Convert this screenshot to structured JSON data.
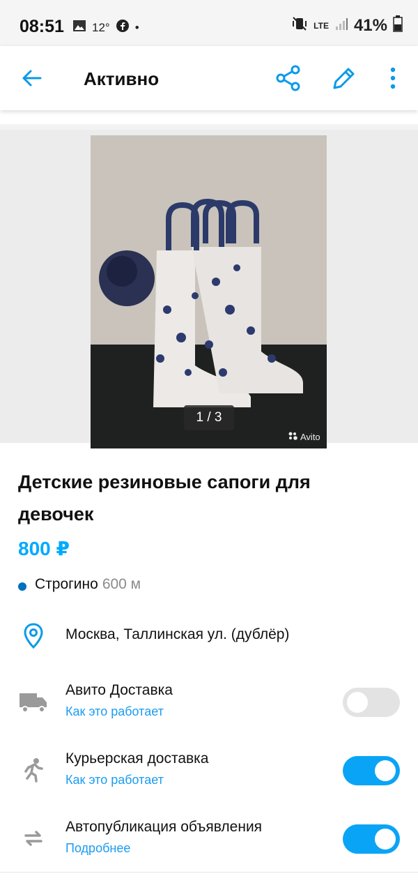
{
  "status_bar": {
    "time": "08:51",
    "temperature": "12°",
    "battery": "41%",
    "network": "LTE",
    "network_sub": "Vo)) LTE1"
  },
  "app_bar": {
    "title": "Активно",
    "back_icon": "arrow-left-icon",
    "share_icon": "share-icon",
    "edit_icon": "pencil-icon",
    "more_icon": "more-vertical-icon"
  },
  "gallery": {
    "counter": "1 / 3",
    "watermark": "Avito"
  },
  "listing": {
    "title": "Детские резиновые сапоги для девочек",
    "price": "800 ₽",
    "metro_station": "Строгино",
    "metro_distance": "600 м",
    "address": "Москва, Таллинская ул. (дублёр)"
  },
  "options": [
    {
      "label": "Авито Доставка",
      "link": "Как это работает",
      "enabled": false,
      "icon": "truck-icon"
    },
    {
      "label": "Курьерская доставка",
      "link": "Как это работает",
      "enabled": true,
      "icon": "courier-running-icon"
    },
    {
      "label": "Автопубликация объявления",
      "link": "Подробнее",
      "enabled": true,
      "icon": "repeat-arrows-icon"
    }
  ],
  "colors": {
    "accent": "#00aaff",
    "toggle_on": "#0aa4f6",
    "toggle_off": "#e3e3e3",
    "metro_dot": "#0070c0"
  }
}
